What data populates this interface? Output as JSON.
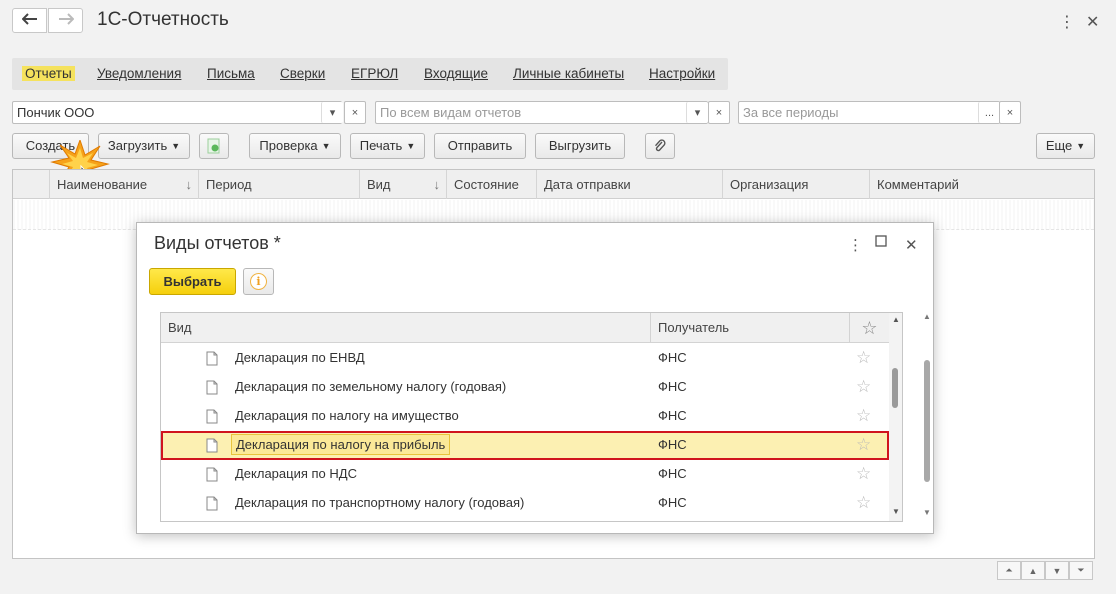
{
  "window": {
    "title": "1С-Отчетность"
  },
  "menu": [
    {
      "label": "Отчеты",
      "active": true
    },
    {
      "label": "Уведомления"
    },
    {
      "label": "Письма"
    },
    {
      "label": "Сверки"
    },
    {
      "label": "ЕГРЮЛ"
    },
    {
      "label": "Входящие"
    },
    {
      "label": "Личные кабинеты"
    },
    {
      "label": "Настройки"
    }
  ],
  "filters": {
    "organization": "Пончик ООО",
    "report_types_placeholder": "По всем видам отчетов",
    "period_placeholder": "За все периоды",
    "dots": "...",
    "clear": "×",
    "dropdown": "▾"
  },
  "toolbar": {
    "create": "Создать",
    "load": "Загрузить",
    "check": "Проверка",
    "print": "Печать",
    "send": "Отправить",
    "export": "Выгрузить",
    "more": "Еще"
  },
  "list_columns": [
    "Наименование",
    "Период",
    "Вид",
    "Состояние",
    "Дата отправки",
    "Организация",
    "Комментарий"
  ],
  "dialog": {
    "title": "Виды отчетов *",
    "select_button": "Выбрать",
    "columns": {
      "vid": "Вид",
      "recipient": "Получатель"
    },
    "rows": [
      {
        "vid": "Декларация по ЕНВД",
        "recipient": "ФНС"
      },
      {
        "vid": "Декларация по земельному налогу (годовая)",
        "recipient": "ФНС"
      },
      {
        "vid": "Декларация по налогу на имущество",
        "recipient": "ФНС"
      },
      {
        "vid": "Декларация по налогу на прибыль",
        "recipient": "ФНС",
        "selected": true
      },
      {
        "vid": "Декларация по НДС",
        "recipient": "ФНС"
      },
      {
        "vid": "Декларация по транспортному налогу (годовая)",
        "recipient": "ФНС"
      }
    ]
  },
  "colors": {
    "accent_yellow": "#f5e25d",
    "select_button": "#f5cf0c",
    "selection_outline": "#d0141e",
    "selection_fill": "#fcf0b2"
  }
}
